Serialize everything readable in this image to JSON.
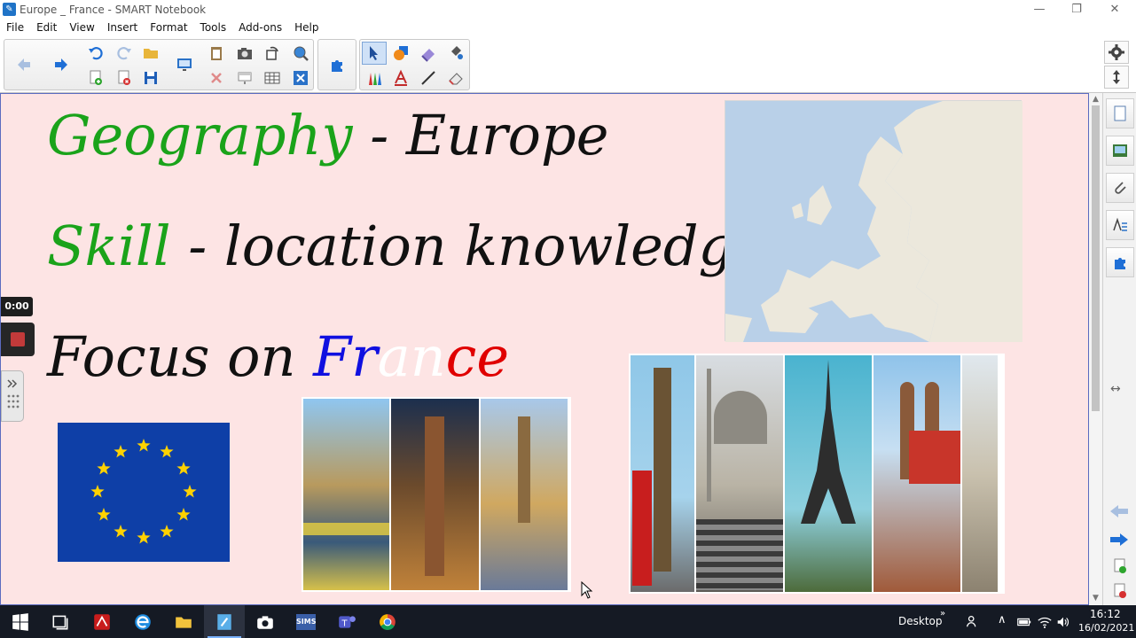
{
  "window": {
    "title": "Europe _ France - SMART Notebook",
    "minimize": "—",
    "maximize": "❐",
    "close": "✕"
  },
  "menu": [
    "File",
    "Edit",
    "View",
    "Insert",
    "Format",
    "Tools",
    "Add-ons",
    "Help"
  ],
  "slide": {
    "line1_green": "Geography",
    "line1_rest": " - Europe",
    "line2_green": "Skill",
    "line2_rest": " - location knowledge",
    "line3_black": "Focus on ",
    "line3_fr": "Fr",
    "line3_an": "an",
    "line3_ce": "ce",
    "colors": {
      "blue": "#1010e0",
      "white": "#ffffff",
      "red": "#e00000",
      "green": "#1aa31a"
    }
  },
  "recorder": {
    "time": "0:00"
  },
  "taskbar": {
    "desktop_label": "Desktop",
    "time": "16:12",
    "date": "16/02/2021",
    "sims_label": "SIMS"
  }
}
